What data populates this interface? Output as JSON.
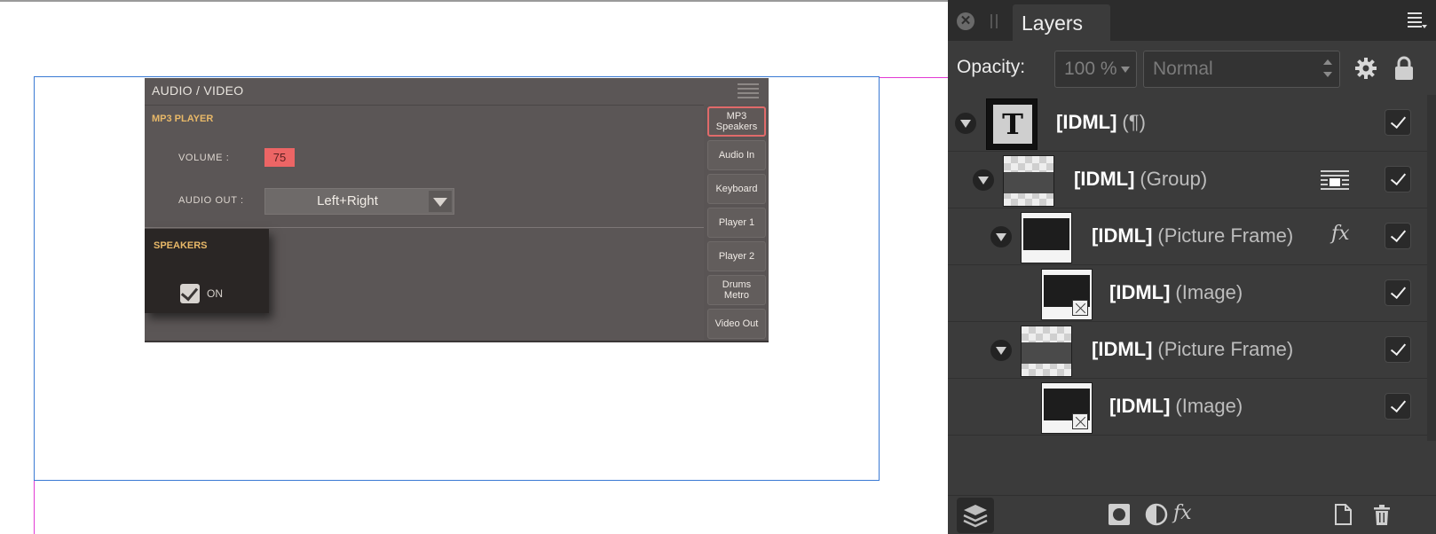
{
  "embedded_ui": {
    "title": "AUDIO / VIDEO",
    "mp3_section": "MP3 PLAYER",
    "volume_label": "VOLUME :",
    "volume_value": "75",
    "audio_out_label": "AUDIO OUT :",
    "audio_out_value": "Left+Right",
    "speakers_section": "SPEAKERS",
    "speakers_on_label": "ON",
    "side_tabs": [
      "MP3\nSpeakers",
      "Audio In",
      "Keyboard",
      "Player 1",
      "Player 2",
      "Drums\nMetro",
      "Video Out"
    ]
  },
  "panel": {
    "tab_label": "Layers",
    "close_glyph": "✕",
    "opacity_label": "Opacity:",
    "opacity_value": "100 %",
    "blend_mode": "Normal",
    "layers": [
      {
        "name": "[IDML]",
        "type": "(¶)",
        "thumb": "text-icon",
        "thumb_glyph": "T",
        "visible": true
      },
      {
        "name": "[IDML]",
        "type": "(Group)",
        "thumb": "checker",
        "visible": true,
        "extra": "text-wrap-icon"
      },
      {
        "name": "[IDML]",
        "type": "(Picture Frame)",
        "thumb": "dark",
        "visible": true,
        "extra": "fx"
      },
      {
        "name": "[IDML]",
        "type": "(Image)",
        "thumb": "image",
        "visible": true
      },
      {
        "name": "[IDML]",
        "type": "(Picture Frame)",
        "thumb": "checker",
        "visible": true
      },
      {
        "name": "[IDML]",
        "type": "(Image)",
        "thumb": "image",
        "visible": true
      }
    ],
    "fx_label": "fx",
    "bottom_fx_label": "fx"
  },
  "colors": {
    "frame_selection": "#3a7ad4",
    "guide": "#e23ad3",
    "panel_bg": "#3b3b3b",
    "volume_highlight": "#ec6565",
    "section_label": "#e8b868"
  }
}
